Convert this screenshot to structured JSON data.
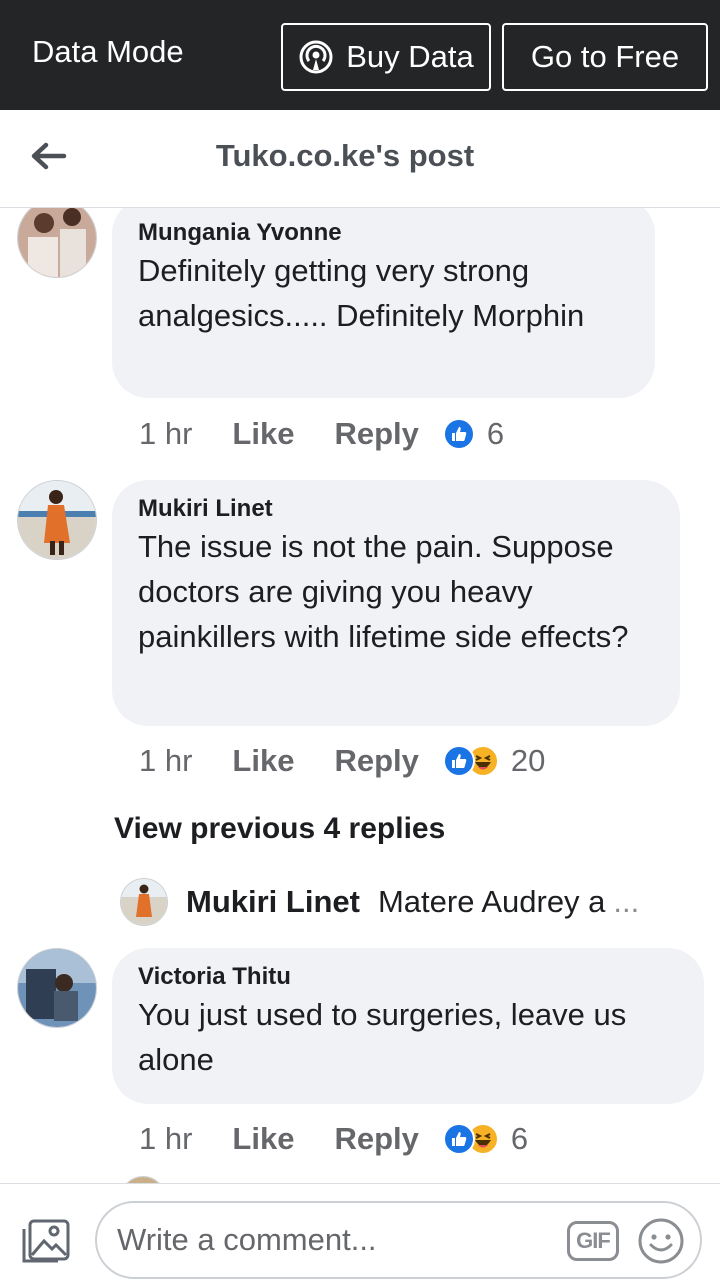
{
  "databar": {
    "mode_label": "Data Mode",
    "buy_label": "Buy Data",
    "free_label": "Go to Free"
  },
  "header": {
    "title": "Tuko.co.ke's post"
  },
  "comments": [
    {
      "author": "Mungania Yvonne",
      "text": "Definitely getting very strong analgesics..... Definitely Morphin",
      "time": "1 hr",
      "like_label": "Like",
      "reply_label": "Reply",
      "reactions": [
        "like"
      ],
      "reaction_count": "6"
    },
    {
      "author": "Mukiri Linet",
      "text": "The issue is not the pain. Suppose doctors are giving you heavy painkillers with lifetime side effects?",
      "time": "1 hr",
      "like_label": "Like",
      "reply_label": "Reply",
      "reactions": [
        "like",
        "haha"
      ],
      "reaction_count": "20"
    },
    {
      "author": "Victoria Thitu",
      "text": "You just used to surgeries,  leave us alone",
      "time": "1 hr",
      "like_label": "Like",
      "reply_label": "Reply",
      "reactions": [
        "like",
        "haha"
      ],
      "reaction_count": "6"
    }
  ],
  "replies": {
    "view_previous_label": "View previous 4 replies",
    "latest": {
      "author": "Mukiri Linet",
      "text": "Matere Audrey a",
      "ellipsis": "..."
    }
  },
  "composer": {
    "placeholder": "Write a comment...",
    "gif_label": "GIF"
  },
  "icons": {
    "back": "arrow-left-icon",
    "buy": "broadcast-icon",
    "photo": "photo-icon",
    "emoji": "smiley-icon",
    "like": "thumbs-up-icon",
    "haha": "laughing-face-icon"
  },
  "colors": {
    "databar": "#242526",
    "bubble": "#f0f2f5",
    "like_blue": "#1b74e4",
    "haha_yellow": "#f7b125",
    "muted": "#65676b"
  }
}
